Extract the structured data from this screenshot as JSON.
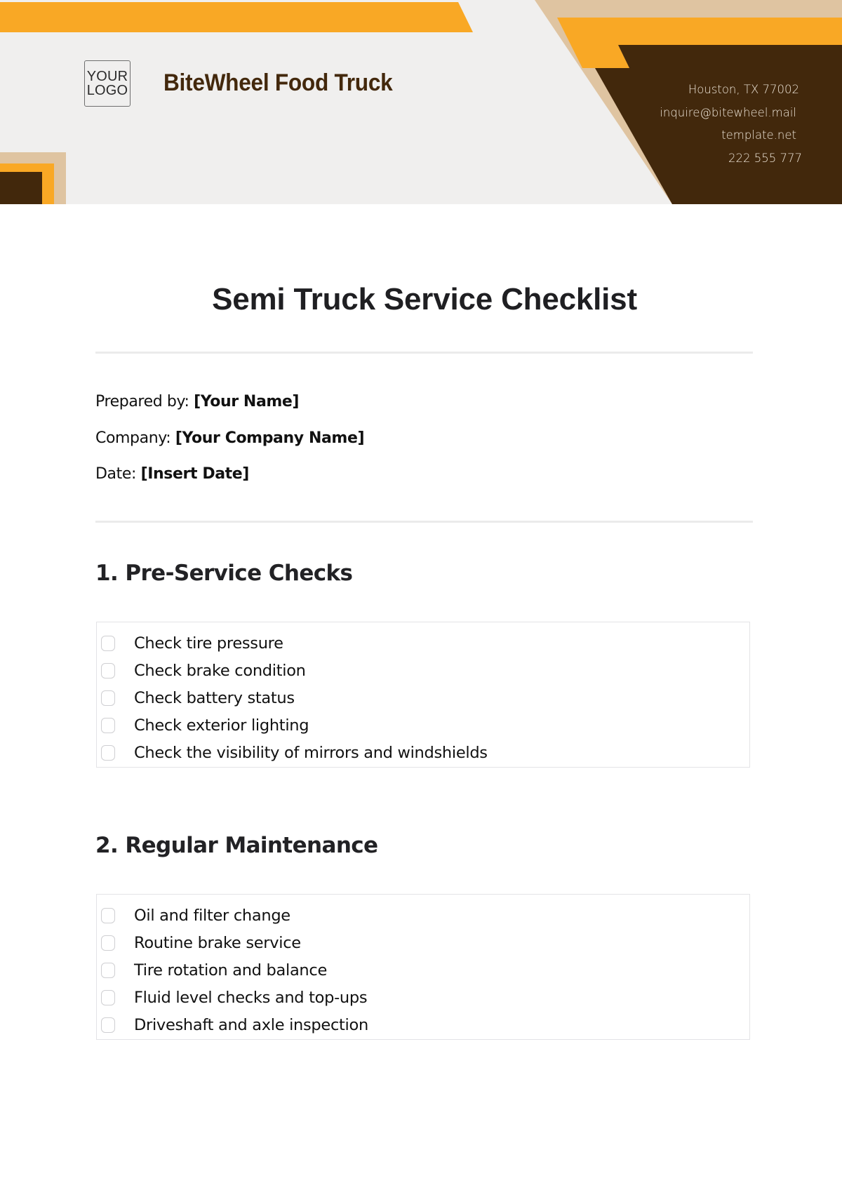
{
  "header": {
    "logo_line1": "YOUR",
    "logo_line2": "LOGO",
    "brand_name": "BiteWheel Food Truck",
    "contact": {
      "address": "Houston, TX 77002",
      "email": "inquire@bitewheel.mail",
      "website": "template.net",
      "phone": "222 555 777"
    },
    "colors": {
      "orange": "#f9a825",
      "beige": "#dfc4a1",
      "dark_brown": "#42280c",
      "background": "#f0efee"
    }
  },
  "document": {
    "title": "Semi Truck Service Checklist",
    "meta": [
      {
        "label": "Prepared by: ",
        "value": "[Your Name]"
      },
      {
        "label": "Company: ",
        "value": "[Your Company Name]"
      },
      {
        "label": "Date: ",
        "value": "[Insert Date]"
      }
    ],
    "sections": [
      {
        "heading": "1. Pre-Service Checks",
        "items": [
          {
            "label": "Check tire pressure",
            "checked": false
          },
          {
            "label": "Check brake condition",
            "checked": false
          },
          {
            "label": "Check battery status",
            "checked": false
          },
          {
            "label": "Check exterior lighting",
            "checked": false
          },
          {
            "label": "Check the visibility of mirrors and windshields",
            "checked": false
          }
        ]
      },
      {
        "heading": "2. Regular Maintenance",
        "items": [
          {
            "label": "Oil and filter change",
            "checked": false
          },
          {
            "label": "Routine brake service",
            "checked": false
          },
          {
            "label": "Tire rotation and balance",
            "checked": false
          },
          {
            "label": "Fluid level checks and top-ups",
            "checked": false
          },
          {
            "label": "Driveshaft and axle inspection",
            "checked": false
          }
        ]
      }
    ]
  }
}
